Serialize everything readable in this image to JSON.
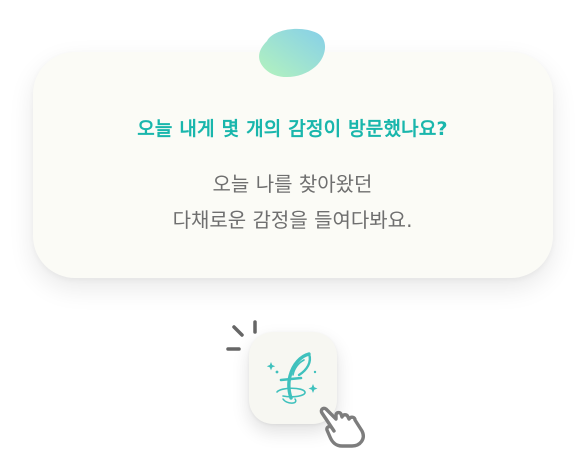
{
  "dialog": {
    "title": "오늘 내게 몇 개의 감정이 방문했나요?",
    "body_line1": "오늘 나를 찾아왔던",
    "body_line2": "다채로운 감정을 들여다봐요."
  },
  "colors": {
    "title": "#19b6ac",
    "body_text": "#6f6f6f",
    "card_background": "#fbfbf6",
    "blob_gradient": [
      "#a8f0c0",
      "#8fd4e8"
    ],
    "icon_feather": "#3fc1bd",
    "hand_outline": "#7d7d7d"
  },
  "icons": {
    "top_decoration": "gradient-blob",
    "app_icon": "feather-f-logo-icon",
    "tap_cue": "sparkle-lines-icon",
    "pointer": "pointing-hand-icon"
  }
}
